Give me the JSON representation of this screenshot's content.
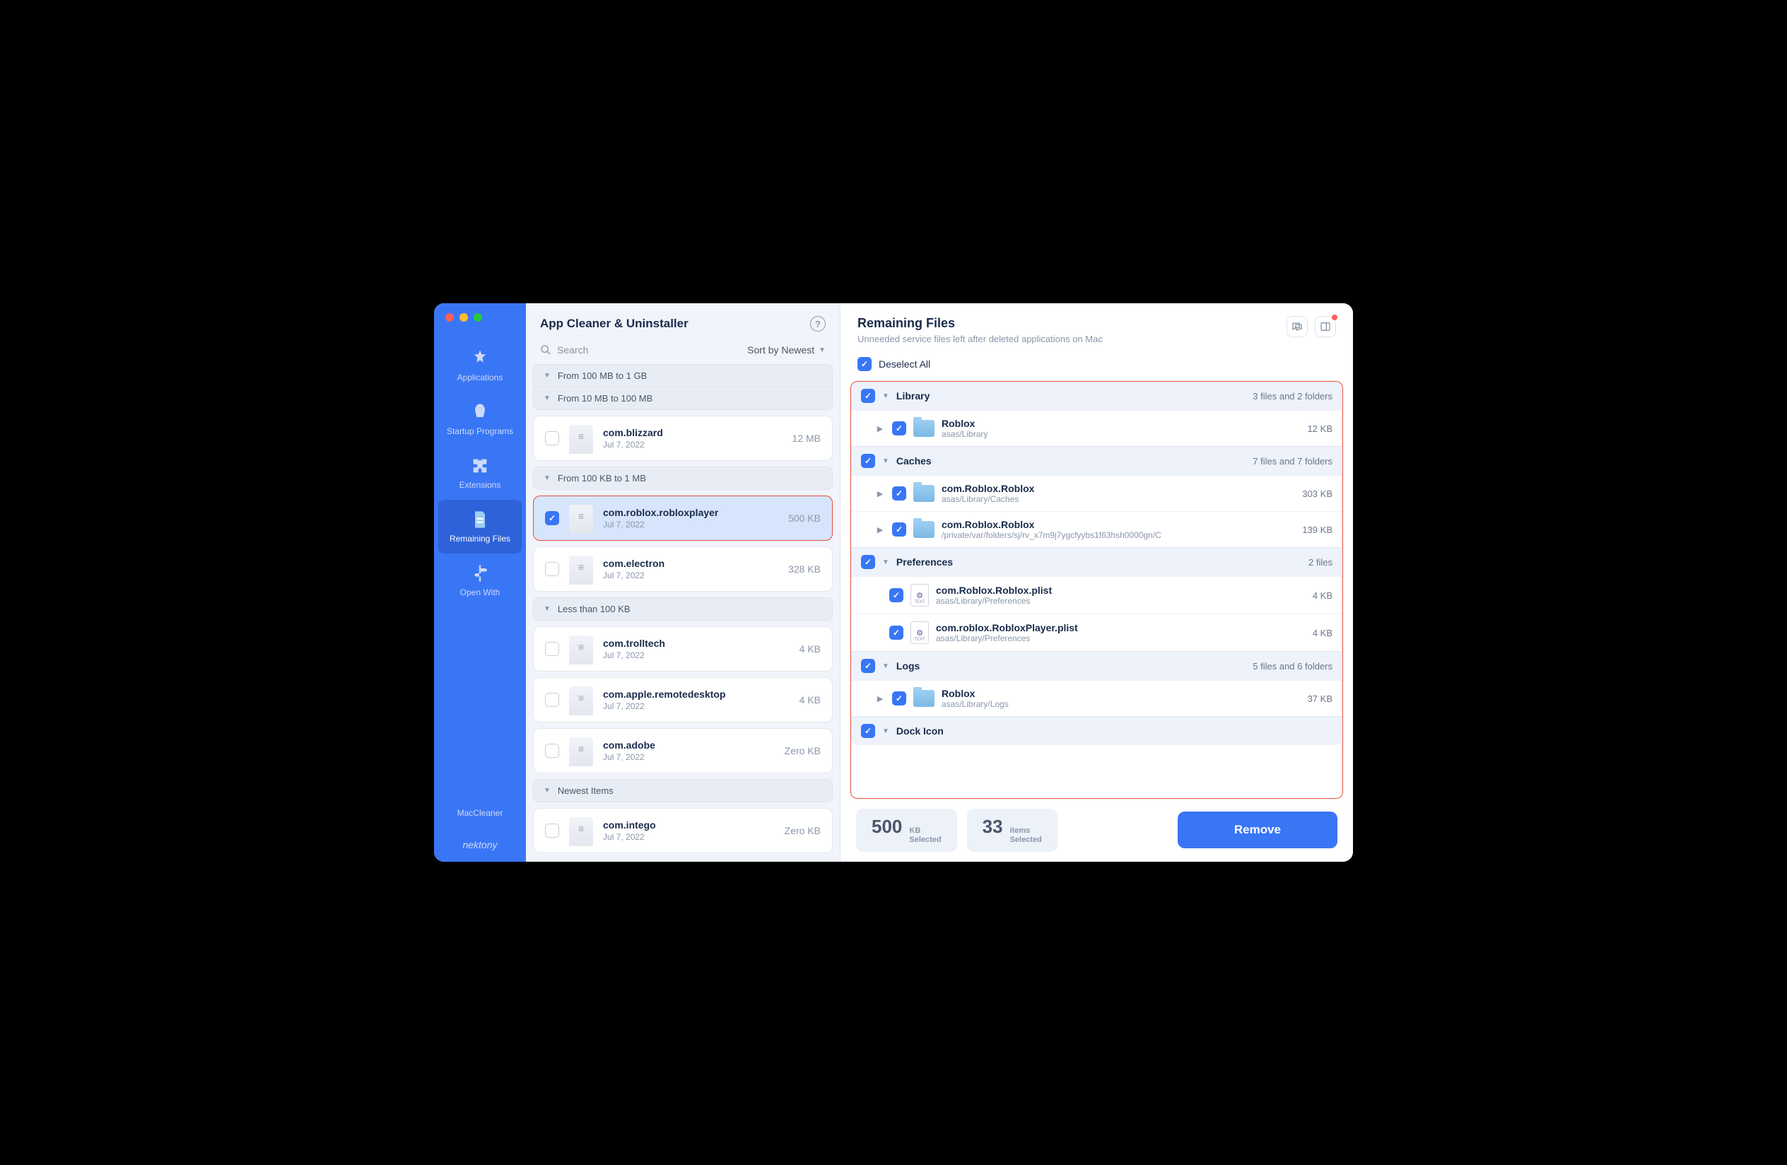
{
  "app_title": "App Cleaner & Uninstaller",
  "brand": "nektony",
  "sidebar": {
    "items": [
      {
        "label": "Applications"
      },
      {
        "label": "Startup Programs"
      },
      {
        "label": "Extensions"
      },
      {
        "label": "Remaining Files"
      },
      {
        "label": "Open With"
      },
      {
        "label": "MacCleaner"
      }
    ]
  },
  "search": {
    "placeholder": "Search"
  },
  "sort": {
    "label": "Sort by Newest"
  },
  "groups": [
    {
      "label": "From 100 MB to 1 GB"
    },
    {
      "label": "From 10 MB to 100 MB"
    },
    {
      "label": "From 100 KB to 1 MB"
    },
    {
      "label": "Less than 100 KB"
    },
    {
      "label": "Newest Items"
    }
  ],
  "apps": [
    {
      "name": "com.blizzard",
      "date": "Jul 7, 2022",
      "size": "12 MB"
    },
    {
      "name": "com.roblox.robloxplayer",
      "date": "Jul 7, 2022",
      "size": "500 KB"
    },
    {
      "name": "com.electron",
      "date": "Jul 7, 2022",
      "size": "328 KB"
    },
    {
      "name": "com.trolltech",
      "date": "Jul 7, 2022",
      "size": "4 KB"
    },
    {
      "name": "com.apple.remotedesktop",
      "date": "Jul 7, 2022",
      "size": "4 KB"
    },
    {
      "name": "com.adobe",
      "date": "Jul 7, 2022",
      "size": "Zero KB"
    },
    {
      "name": "com.intego",
      "date": "Jul 7, 2022",
      "size": "Zero KB"
    }
  ],
  "detail": {
    "title": "Remaining Files",
    "subtitle": "Unneeded service files left after deleted applications on Mac",
    "deselect": "Deselect All"
  },
  "categories": [
    {
      "name": "Library",
      "count": "3 files and 2 folders",
      "files": [
        {
          "name": "Roblox",
          "path": "asas/Library",
          "size": "12 KB",
          "type": "folder"
        }
      ]
    },
    {
      "name": "Caches",
      "count": "7 files and 7 folders",
      "files": [
        {
          "name": "com.Roblox.Roblox",
          "path": "asas/Library/Caches",
          "size": "303 KB",
          "type": "folder"
        },
        {
          "name": "com.Roblox.Roblox",
          "path": "/private/var/folders/sj/rv_x7m9j7ygcfyybs1f63hsh0000gn/C",
          "size": "139 KB",
          "type": "folder"
        }
      ]
    },
    {
      "name": "Preferences",
      "count": "2 files",
      "files": [
        {
          "name": "com.Roblox.Roblox.plist",
          "path": "asas/Library/Preferences",
          "size": "4 KB",
          "type": "plist"
        },
        {
          "name": "com.roblox.RobloxPlayer.plist",
          "path": "asas/Library/Preferences",
          "size": "4 KB",
          "type": "plist"
        }
      ]
    },
    {
      "name": "Logs",
      "count": "5 files and 6 folders",
      "files": [
        {
          "name": "Roblox",
          "path": "asas/Library/Logs",
          "size": "37 KB",
          "type": "folder"
        }
      ]
    },
    {
      "name": "Dock Icon",
      "count": "",
      "files": []
    }
  ],
  "footer": {
    "size_num": "500",
    "size_unit": "KB",
    "size_label": "Selected",
    "count_num": "33",
    "count_unit": "items",
    "count_label": "Selected",
    "remove": "Remove"
  }
}
